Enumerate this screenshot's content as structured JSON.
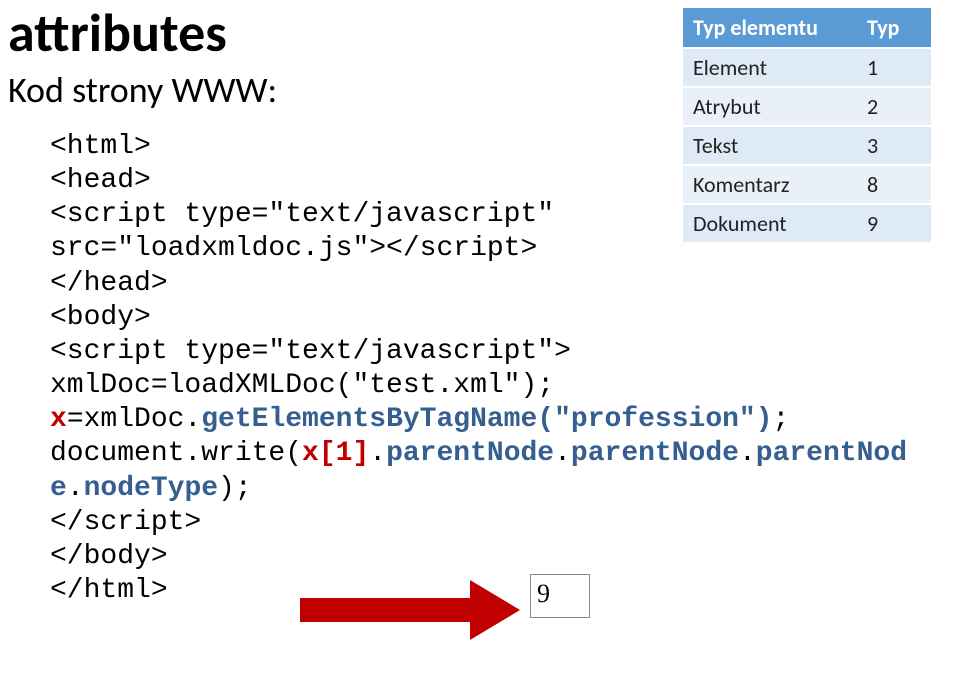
{
  "title": "attributes",
  "subtitle": "Kod strony WWW:",
  "table": {
    "headers": [
      "Typ elementu",
      "Typ"
    ],
    "rows": [
      {
        "name": "Element",
        "value": "1"
      },
      {
        "name": "Atrybut",
        "value": "2"
      },
      {
        "name": "Tekst",
        "value": "3"
      },
      {
        "name": "Komentarz",
        "value": "8"
      },
      {
        "name": "Dokument",
        "value": "9"
      }
    ]
  },
  "code": {
    "l1": "<html>",
    "l2": "<head>",
    "l3": "<script type=\"text/javascript\"",
    "l4": "src=\"loadxmldoc.js\"></script>",
    "l5": "</head>",
    "l6": "<body>",
    "l7": "<script type=\"text/javascript\">",
    "l8": "xmlDoc=loadXMLDoc(\"test.xml\");",
    "l9a": "x",
    "l9b": "=xmlDoc.",
    "l9c": "getElementsByTagName(\"profession\")",
    "l9d": ";",
    "l10a": "document.write(",
    "l10b": "x[1]",
    "l10c": ".",
    "l10d": "parentNode",
    "l10e": ".",
    "l10f": "parentNode",
    "l10g": ".",
    "l10h": "parentNod",
    "l11a": "e",
    "l11b": ".",
    "l11c": "nodeType",
    "l11d": ");",
    "l12": "</script>",
    "l13": "</body>",
    "l14": "</html>"
  },
  "output": "9"
}
